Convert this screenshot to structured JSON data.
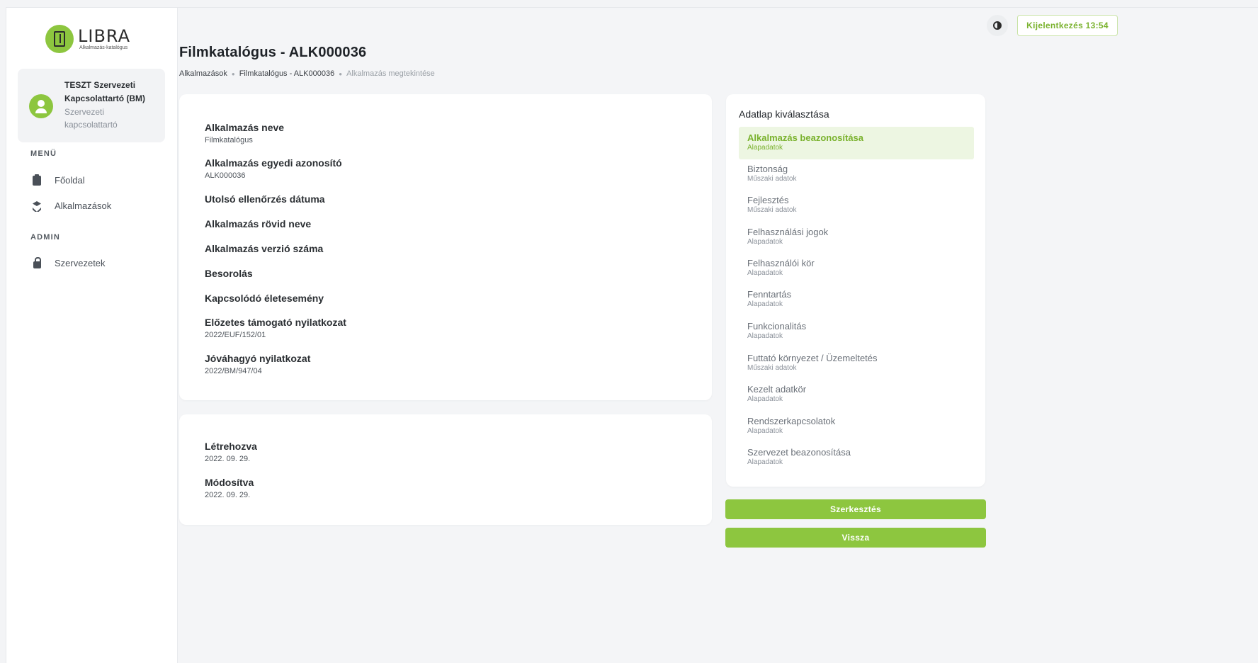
{
  "brand": {
    "title": "LIBRA",
    "subtitle": "Alkalmazás-katalógus"
  },
  "user": {
    "name": "TESZT Szervezeti Kapcsolattartó (BM)",
    "role": "Szervezeti kapcsolattartó"
  },
  "sidebar": {
    "menu_title": "MENÜ",
    "menu_items": [
      {
        "label": "Főoldal",
        "icon": "clipboard-icon"
      },
      {
        "label": "Alkalmazások",
        "icon": "layers-icon"
      }
    ],
    "admin_title": "ADMIN",
    "admin_items": [
      {
        "label": "Szervezetek",
        "icon": "lock-icon"
      }
    ]
  },
  "topbar": {
    "logout_label": "Kijelentkezés 13:54"
  },
  "header": {
    "title": "Filmkatalógus - ALK000036",
    "breadcrumb": [
      "Alkalmazások",
      "Filmkatalógus - ALK000036",
      "Alkalmazás megtekintése"
    ]
  },
  "fields": [
    {
      "label": "Alkalmazás neve",
      "value": "Filmkatalógus"
    },
    {
      "label": "Alkalmazás egyedi azonosító",
      "value": "ALK000036"
    },
    {
      "label": "Utolsó ellenőrzés dátuma",
      "value": ""
    },
    {
      "label": "Alkalmazás rövid neve",
      "value": ""
    },
    {
      "label": "Alkalmazás verzió száma",
      "value": ""
    },
    {
      "label": "Besorolás",
      "value": ""
    },
    {
      "label": "Kapcsolódó életesemény",
      "value": ""
    },
    {
      "label": "Előzetes támogató nyilatkozat",
      "value": "2022/EUF/152/01"
    },
    {
      "label": "Jóváhagyó nyilatkozat",
      "value": "2022/BM/947/04"
    }
  ],
  "meta": [
    {
      "label": "Létrehozva",
      "value": "2022. 09. 29."
    },
    {
      "label": "Módosítva",
      "value": "2022. 09. 29."
    }
  ],
  "datasheet": {
    "title": "Adatlap kiválasztása",
    "items": [
      {
        "title": "Alkalmazás beazonosítása",
        "subtitle": "Alapadatok",
        "active": true
      },
      {
        "title": "Biztonság",
        "subtitle": "Műszaki adatok"
      },
      {
        "title": "Fejlesztés",
        "subtitle": "Műszaki adatok"
      },
      {
        "title": "Felhasználási jogok",
        "subtitle": "Alapadatok"
      },
      {
        "title": "Felhasználói kör",
        "subtitle": "Alapadatok"
      },
      {
        "title": "Fenntartás",
        "subtitle": "Alapadatok"
      },
      {
        "title": "Funkcionalitás",
        "subtitle": "Alapadatok"
      },
      {
        "title": "Futtató környezet / Üzemeltetés",
        "subtitle": "Műszaki adatok"
      },
      {
        "title": "Kezelt adatkör",
        "subtitle": "Alapadatok"
      },
      {
        "title": "Rendszerkapcsolatok",
        "subtitle": "Alapadatok"
      },
      {
        "title": "Szervezet beazonosítása",
        "subtitle": "Alapadatok"
      }
    ]
  },
  "actions": {
    "edit_label": "Szerkesztés",
    "back_label": "Vissza"
  },
  "colors": {
    "accent": "#8dc63f",
    "accent_text": "#7ab22e"
  }
}
